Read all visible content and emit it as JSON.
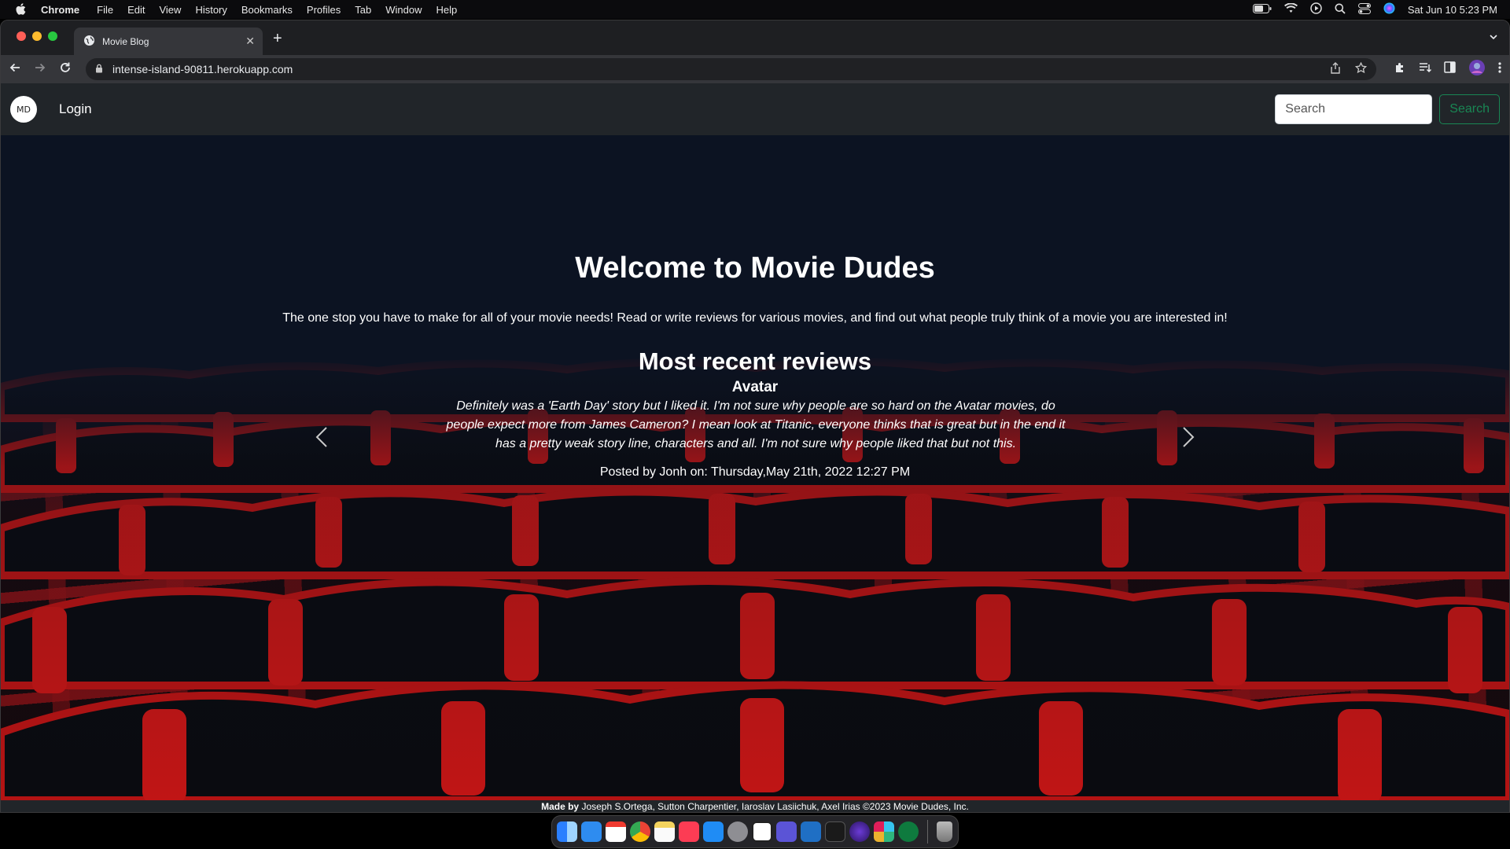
{
  "menubar": {
    "app": "Chrome",
    "items": [
      "File",
      "Edit",
      "View",
      "History",
      "Bookmarks",
      "Profiles",
      "Tab",
      "Window",
      "Help"
    ],
    "clock": "Sat Jun 10  5:23 PM"
  },
  "browser": {
    "tab_title": "Movie Blog",
    "url": "intense-island-90811.herokuapp.com"
  },
  "navbar": {
    "brand": "MD",
    "login": "Login",
    "search_placeholder": "Search",
    "search_button": "Search"
  },
  "hero": {
    "title": "Welcome to Movie Dudes",
    "tagline": "The one stop you have to make for all of your movie needs! Read or write reviews for various movies, and find out what people truly think of a movie you are interested in!",
    "recent_heading": "Most recent reviews",
    "review": {
      "movie": "Avatar",
      "text": "Definitely was a 'Earth Day' story but I liked it. I'm not sure why people are so hard on the Avatar movies, do people expect more from James Cameron? I mean look at Titanic, everyone thinks that is great but in the end it has a pretty weak story line, characters and all. I'm not sure why people liked that but not this.",
      "posted": "Posted by Jonh on: Thursday,May 21th, 2022 12:27 PM"
    }
  },
  "footer": {
    "made_by_label": "Made by",
    "made_by_text": " Joseph S.Ortega, Sutton Charpentier, Iaroslav Lasiichuk, Axel Irias ©2023 Movie Dudes, Inc."
  },
  "colors": {
    "navbar_bg": "#212529",
    "search_button": "#198754",
    "hero_bg": "#0c1322",
    "seat_red": "#c01515"
  }
}
